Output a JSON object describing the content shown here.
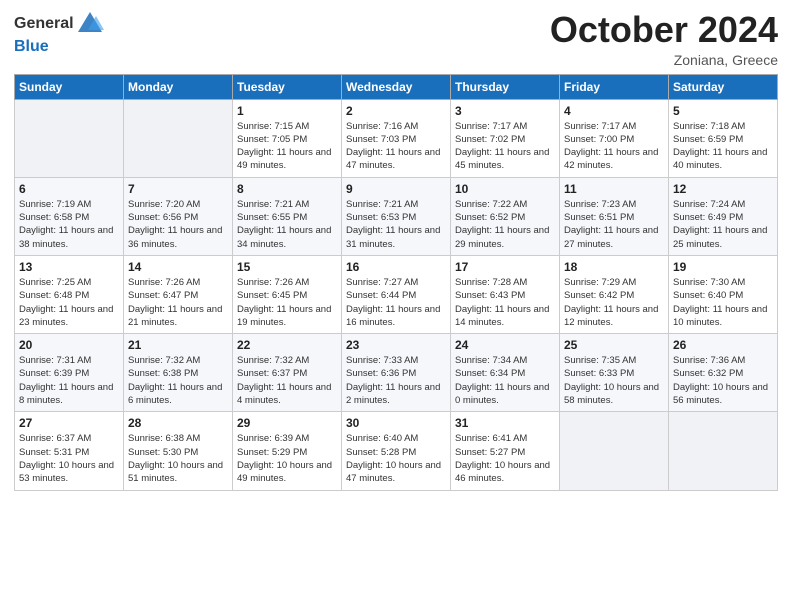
{
  "header": {
    "logo_general": "General",
    "logo_blue": "Blue",
    "month_title": "October 2024",
    "subtitle": "Zoniana, Greece"
  },
  "days_of_week": [
    "Sunday",
    "Monday",
    "Tuesday",
    "Wednesday",
    "Thursday",
    "Friday",
    "Saturday"
  ],
  "weeks": [
    [
      {
        "day": "",
        "info": ""
      },
      {
        "day": "",
        "info": ""
      },
      {
        "day": "1",
        "info": "Sunrise: 7:15 AM\nSunset: 7:05 PM\nDaylight: 11 hours and 49 minutes."
      },
      {
        "day": "2",
        "info": "Sunrise: 7:16 AM\nSunset: 7:03 PM\nDaylight: 11 hours and 47 minutes."
      },
      {
        "day": "3",
        "info": "Sunrise: 7:17 AM\nSunset: 7:02 PM\nDaylight: 11 hours and 45 minutes."
      },
      {
        "day": "4",
        "info": "Sunrise: 7:17 AM\nSunset: 7:00 PM\nDaylight: 11 hours and 42 minutes."
      },
      {
        "day": "5",
        "info": "Sunrise: 7:18 AM\nSunset: 6:59 PM\nDaylight: 11 hours and 40 minutes."
      }
    ],
    [
      {
        "day": "6",
        "info": "Sunrise: 7:19 AM\nSunset: 6:58 PM\nDaylight: 11 hours and 38 minutes."
      },
      {
        "day": "7",
        "info": "Sunrise: 7:20 AM\nSunset: 6:56 PM\nDaylight: 11 hours and 36 minutes."
      },
      {
        "day": "8",
        "info": "Sunrise: 7:21 AM\nSunset: 6:55 PM\nDaylight: 11 hours and 34 minutes."
      },
      {
        "day": "9",
        "info": "Sunrise: 7:21 AM\nSunset: 6:53 PM\nDaylight: 11 hours and 31 minutes."
      },
      {
        "day": "10",
        "info": "Sunrise: 7:22 AM\nSunset: 6:52 PM\nDaylight: 11 hours and 29 minutes."
      },
      {
        "day": "11",
        "info": "Sunrise: 7:23 AM\nSunset: 6:51 PM\nDaylight: 11 hours and 27 minutes."
      },
      {
        "day": "12",
        "info": "Sunrise: 7:24 AM\nSunset: 6:49 PM\nDaylight: 11 hours and 25 minutes."
      }
    ],
    [
      {
        "day": "13",
        "info": "Sunrise: 7:25 AM\nSunset: 6:48 PM\nDaylight: 11 hours and 23 minutes."
      },
      {
        "day": "14",
        "info": "Sunrise: 7:26 AM\nSunset: 6:47 PM\nDaylight: 11 hours and 21 minutes."
      },
      {
        "day": "15",
        "info": "Sunrise: 7:26 AM\nSunset: 6:45 PM\nDaylight: 11 hours and 19 minutes."
      },
      {
        "day": "16",
        "info": "Sunrise: 7:27 AM\nSunset: 6:44 PM\nDaylight: 11 hours and 16 minutes."
      },
      {
        "day": "17",
        "info": "Sunrise: 7:28 AM\nSunset: 6:43 PM\nDaylight: 11 hours and 14 minutes."
      },
      {
        "day": "18",
        "info": "Sunrise: 7:29 AM\nSunset: 6:42 PM\nDaylight: 11 hours and 12 minutes."
      },
      {
        "day": "19",
        "info": "Sunrise: 7:30 AM\nSunset: 6:40 PM\nDaylight: 11 hours and 10 minutes."
      }
    ],
    [
      {
        "day": "20",
        "info": "Sunrise: 7:31 AM\nSunset: 6:39 PM\nDaylight: 11 hours and 8 minutes."
      },
      {
        "day": "21",
        "info": "Sunrise: 7:32 AM\nSunset: 6:38 PM\nDaylight: 11 hours and 6 minutes."
      },
      {
        "day": "22",
        "info": "Sunrise: 7:32 AM\nSunset: 6:37 PM\nDaylight: 11 hours and 4 minutes."
      },
      {
        "day": "23",
        "info": "Sunrise: 7:33 AM\nSunset: 6:36 PM\nDaylight: 11 hours and 2 minutes."
      },
      {
        "day": "24",
        "info": "Sunrise: 7:34 AM\nSunset: 6:34 PM\nDaylight: 11 hours and 0 minutes."
      },
      {
        "day": "25",
        "info": "Sunrise: 7:35 AM\nSunset: 6:33 PM\nDaylight: 10 hours and 58 minutes."
      },
      {
        "day": "26",
        "info": "Sunrise: 7:36 AM\nSunset: 6:32 PM\nDaylight: 10 hours and 56 minutes."
      }
    ],
    [
      {
        "day": "27",
        "info": "Sunrise: 6:37 AM\nSunset: 5:31 PM\nDaylight: 10 hours and 53 minutes."
      },
      {
        "day": "28",
        "info": "Sunrise: 6:38 AM\nSunset: 5:30 PM\nDaylight: 10 hours and 51 minutes."
      },
      {
        "day": "29",
        "info": "Sunrise: 6:39 AM\nSunset: 5:29 PM\nDaylight: 10 hours and 49 minutes."
      },
      {
        "day": "30",
        "info": "Sunrise: 6:40 AM\nSunset: 5:28 PM\nDaylight: 10 hours and 47 minutes."
      },
      {
        "day": "31",
        "info": "Sunrise: 6:41 AM\nSunset: 5:27 PM\nDaylight: 10 hours and 46 minutes."
      },
      {
        "day": "",
        "info": ""
      },
      {
        "day": "",
        "info": ""
      }
    ]
  ]
}
